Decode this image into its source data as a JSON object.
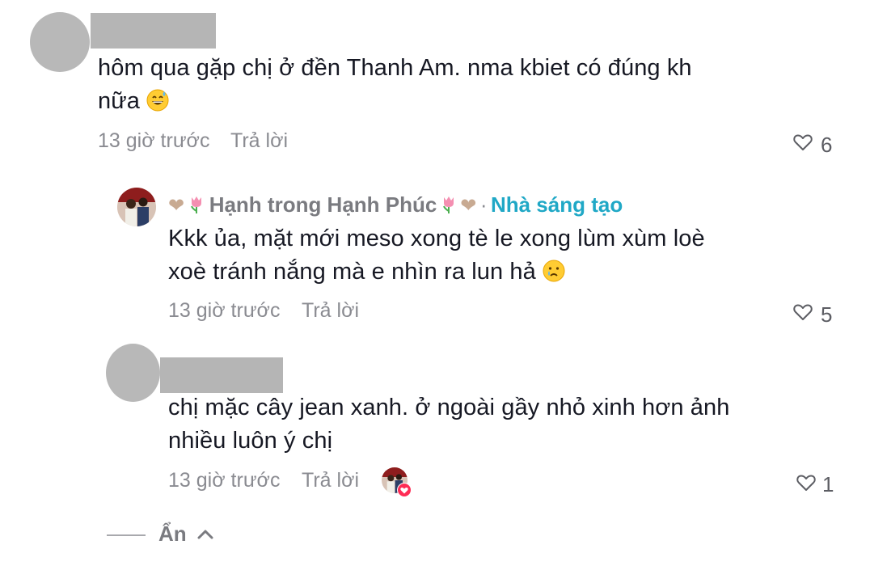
{
  "comments": [
    {
      "text_line1": "hôm qua gặp chị ở đền Thanh Am. nma kbiet có đúng kh",
      "text_line2": "nữa",
      "emoji": "grinning-sweat-emoji",
      "time": "13 giờ trước",
      "reply_label": "Trả lời",
      "likes": "6"
    },
    {
      "author": "Hạnh trong Hạnh Phúc",
      "badge_separator": "·",
      "badge": "Nhà sáng tạo",
      "text_line1": "Kkk ủa, mặt mới meso xong tè le xong lùm xùm loè",
      "text_line2": "xoè tránh nắng mà e nhìn ra lun hả",
      "emoji": "crying-smile-emoji",
      "time": "13 giờ trước",
      "reply_label": "Trả lời",
      "likes": "5"
    },
    {
      "text_line1": "chị mặc cây jean xanh. ở ngoài gầy nhỏ xinh hơn ảnh",
      "text_line2": "nhiều luôn ý chị",
      "time": "13 giờ trước",
      "reply_label": "Trả lời",
      "likes": "1"
    }
  ],
  "hide_label": "Ẩn",
  "colors": {
    "creator_badge": "#20a8c6",
    "meta": "#8a8b91",
    "text": "#161823",
    "liked_by_creator": "#fe2c55"
  }
}
